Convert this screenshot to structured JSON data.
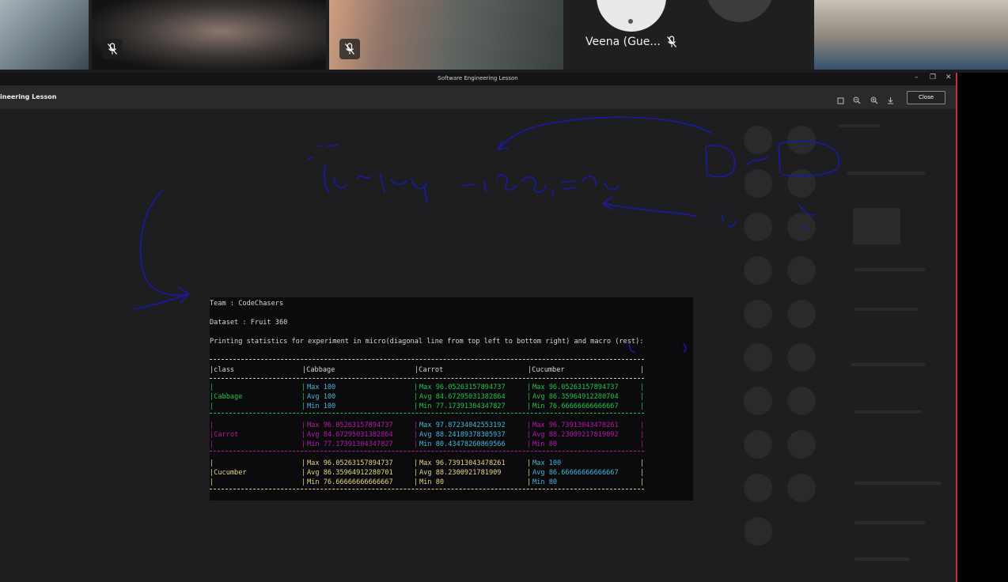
{
  "participants": {
    "guest_name": "Veena (Gue..."
  },
  "window": {
    "title": "Software Engineering Lesson",
    "doc_title": "ineering Lesson",
    "close_label": "Close",
    "controls": {
      "minimize": "–",
      "restore": "❐",
      "close": "✕"
    }
  },
  "terminal": {
    "team_line": "Team : CodeChasers",
    "dataset_line": "Dataset : Fruit 360",
    "printing_line": "Printing statistics for experiment in micro(diagonal line from top left to bottom right) and macro (rest):",
    "header": [
      "|class",
      "|Cabbage",
      "|Carrot",
      "|Cucumber"
    ],
    "rows": [
      {
        "label": "Cabbage",
        "cells": [
          [
            "Max 100",
            "Avg 100",
            "Min 100"
          ],
          [
            "Max 96.05263157894737",
            "Avg 84.67295031382864",
            "Min 77.17391304347827"
          ],
          [
            "Max 96.05263157894737",
            "Avg 86.35964912280704",
            "Min 76.66666666666667"
          ]
        ]
      },
      {
        "label": "Carrot",
        "cells": [
          [
            "Max 96.05263157894737",
            "Avg 84.67295031382864",
            "Min 77.17391304347827"
          ],
          [
            "Max 97.87234042553192",
            "Avg 88.24189378305937",
            "Min 80.43478260869566"
          ],
          [
            "Max 96.73913043478261",
            "Avg 88.23009217819092",
            "Min 80"
          ]
        ]
      },
      {
        "label": "Cucumber",
        "cells": [
          [
            "Max 96.05263157894737",
            "Avg 86.35964912280701",
            "Min 76.66666666666667"
          ],
          [
            "Max 96.73913043478261",
            "Avg 88.2300921781909",
            "Min 80"
          ],
          [
            "Max 100",
            "Avg 86.66666666666667",
            "Min 80"
          ]
        ]
      }
    ]
  },
  "colors": {
    "green": "#23c24a",
    "magenta": "#b51aa5",
    "yellow": "#e6d48a",
    "cyan": "#49b5d6",
    "ink": "#1a1aa8",
    "accent_red": "#c4314b"
  },
  "icons": [
    "mic-off-icon",
    "fit-page-icon",
    "zoom-out-icon",
    "zoom-in-icon",
    "download-icon"
  ]
}
